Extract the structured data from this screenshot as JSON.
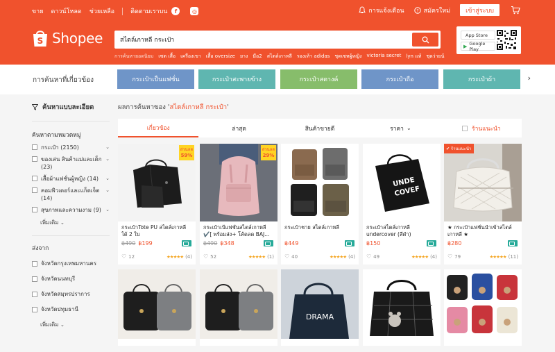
{
  "topnav": {
    "sell": "ขาย",
    "download": "ดาวน์โหลด",
    "help": "ช่วยเหลือ",
    "follow": "ติดตามเราบน",
    "notifications": "การแจ้งเตือน",
    "signup": "สมัครใหม่",
    "login": "เข้าสู่ระบบ"
  },
  "brand": "Shopee",
  "search": {
    "value": "สไตล์เกาหลี กระเป๋า",
    "suggestions": [
      "การค้นหายอดนิยม",
      "เซต เสื้อ",
      "เครื่องเขา",
      "เสื้อ oversize",
      "ยาง",
      "มือ2",
      "สไตล์เกาหลี",
      "รองเท้า adidas",
      "ชุดเซทผู้หญิง",
      "victoria secret",
      "lyn แท้",
      "ชุดว่ายน้"
    ]
  },
  "apps": {
    "appstore": "App Store",
    "googleplay": "Google Play"
  },
  "related": {
    "title": "การค้นหาที่เกี่ยวข้อง",
    "chips": [
      {
        "label": "กระเป๋าเป็นแฟชั่น",
        "color": "#6f95c8"
      },
      {
        "label": "กระเป๋าสะพายข้าง",
        "color": "#5fb6b0"
      },
      {
        "label": "กระเป๋าสตางค์",
        "color": "#87bd6b"
      },
      {
        "label": "กระเป๋าถือ",
        "color": "#6f95c8"
      },
      {
        "label": "กระเป๋าผ้า",
        "color": "#5fb6b0"
      }
    ]
  },
  "sidebar": {
    "filter_title": "ค้นหาแบบละเอียด",
    "category_title": "ค้นหาตามหมวดหมู่",
    "categories": [
      {
        "label": "กระเป๋า (2150)"
      },
      {
        "label": "ของเล่น สินค้าแม่และเด็ก (23)"
      },
      {
        "label": "เสื้อผ้าแฟชั่นผู้หญิง (14)"
      },
      {
        "label": "คอมพิวเตอร์และแก็ดเจ็ต (14)"
      },
      {
        "label": "สุขภาพและความงาม (9)"
      }
    ],
    "more": "เพิ่มเติม",
    "location_title": "ส่งจาก",
    "locations": [
      "จังหวัดกรุงเทพมหานคร",
      "จังหวัดนนทบุรี",
      "จังหวัดสมุทรปราการ",
      "จังหวัดปทุมธานี"
    ],
    "more2": "เพิ่มเติม"
  },
  "results": {
    "prefix": "ผลการค้นหาของ '",
    "query": "สไตล์เกาหลี กระเป๋า",
    "suffix": "'"
  },
  "sort": {
    "relevant": "เกี่ยวข้อง",
    "latest": "ล่าสุด",
    "top_sales": "สินค้าขายดี",
    "price": "ราคา",
    "recommended": "ร้านแนะนำ"
  },
  "products": [
    {
      "name": "กระเป๋าTote PU สไตล์เกาหลี ได้ 2 ใบ",
      "old_price": "฿490",
      "price": "฿199",
      "likes": "12",
      "reviews": "(4)",
      "sale_label": "ส่วนลด",
      "sale_pct": "59%"
    },
    {
      "name": "กระเป๋าเป้แฟชั่นสไตล์เกาหลี ✔️[ พร้อมส่ง+ โค้ดลด BAJ...",
      "old_price": "฿490",
      "price": "฿348",
      "likes": "52",
      "reviews": "(1)",
      "sale_label": "ส่วนลด",
      "sale_pct": "29%"
    },
    {
      "name": "กระเป๋าชาย สไตล์เกาหลี",
      "old_price": "",
      "price": "฿449",
      "likes": "40",
      "reviews": "(4)"
    },
    {
      "name": "กระเป๋าสไตล์เกาหลี undercover (สีดำ)",
      "old_price": "",
      "price": "฿150",
      "likes": "49",
      "reviews": "(4)",
      "bag_text": "UNDE\nCOVEF"
    },
    {
      "name": "★ กระเป๋าแฟชั่นนำเข้าสไตล์เกาหลี ★",
      "old_price": "",
      "price": "฿280",
      "likes": "79",
      "reviews": "(11)",
      "rec_label": "✔ ร้านแนะนำ"
    }
  ],
  "drama_text": "DRAMA",
  "colors": {
    "brand": "#f0522d",
    "stars": "#f5a623",
    "ship": "#26aa99"
  }
}
